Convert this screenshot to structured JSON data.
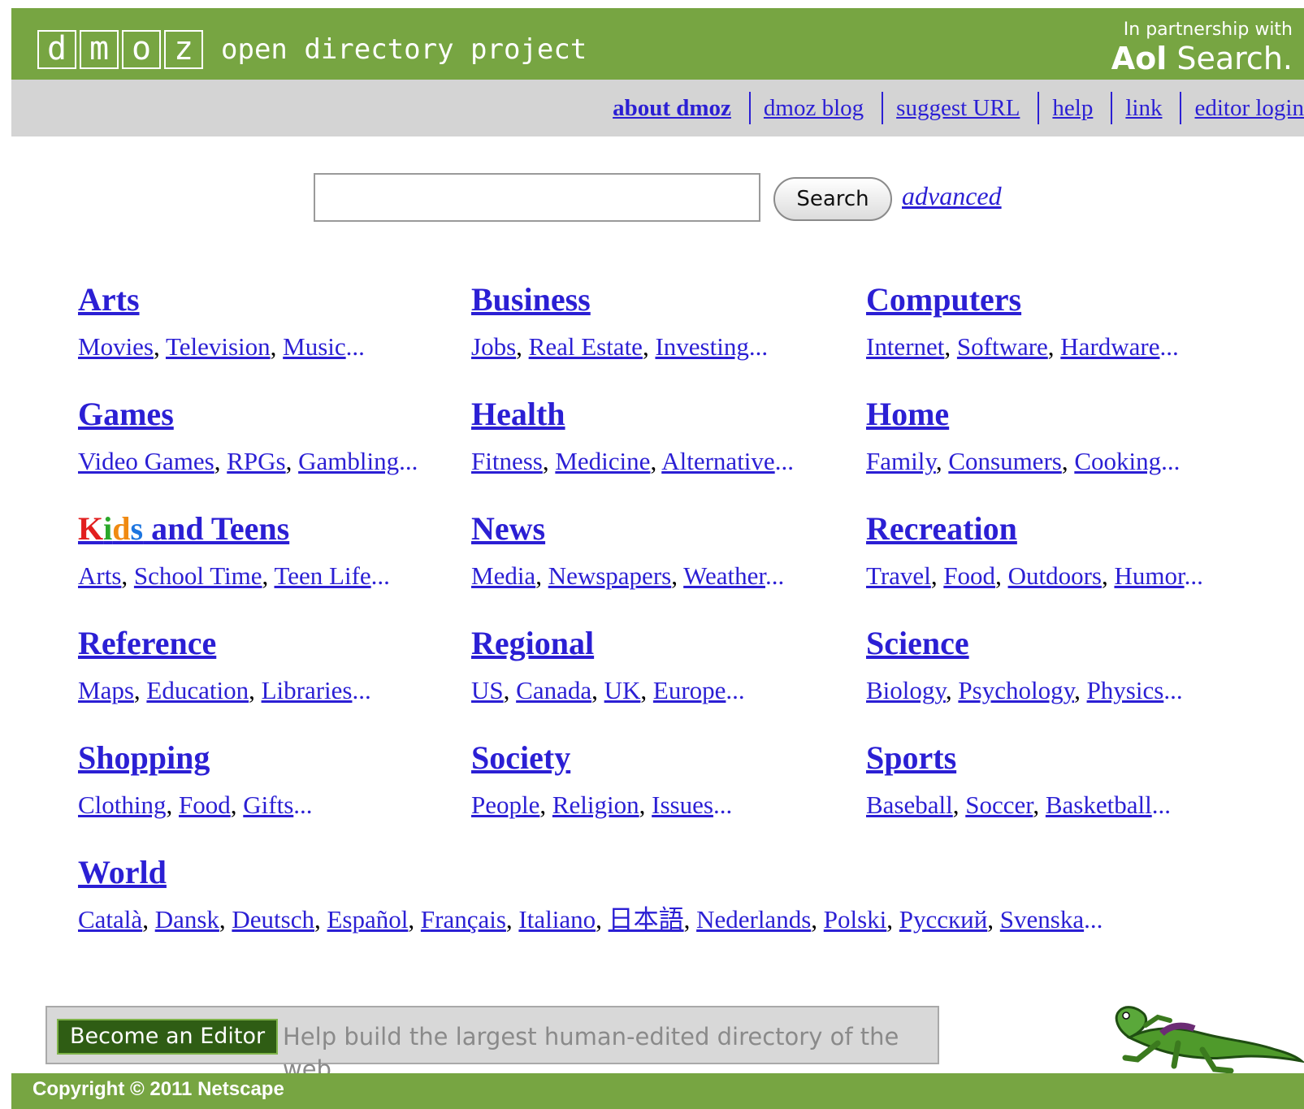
{
  "header": {
    "logo_letters": [
      "d",
      "m",
      "o",
      "z"
    ],
    "tagline": "open directory project",
    "partner_small": "In partnership with",
    "partner_brand_bold": "Aol",
    "partner_brand_rest": " Search."
  },
  "nav": {
    "items": [
      {
        "label": "about dmoz",
        "bold": true
      },
      {
        "label": "dmoz blog"
      },
      {
        "label": "suggest URL"
      },
      {
        "label": "help"
      },
      {
        "label": "link"
      },
      {
        "label": "editor login"
      }
    ]
  },
  "search": {
    "value": "",
    "placeholder": "",
    "button_label": "Search",
    "advanced_label": "advanced"
  },
  "categories": [
    {
      "title": "Arts",
      "subs": [
        "Movies",
        "Television",
        "Music"
      ]
    },
    {
      "title": "Business",
      "subs": [
        "Jobs",
        "Real Estate",
        "Investing"
      ]
    },
    {
      "title": "Computers",
      "subs": [
        "Internet",
        "Software",
        "Hardware"
      ]
    },
    {
      "title": "Games",
      "subs": [
        "Video Games",
        "RPGs",
        "Gambling"
      ]
    },
    {
      "title": "Health",
      "subs": [
        "Fitness",
        "Medicine",
        "Alternative"
      ]
    },
    {
      "title": "Home",
      "subs": [
        "Family",
        "Consumers",
        "Cooking"
      ]
    },
    {
      "title_kids": [
        "K",
        "i",
        "d",
        "s"
      ],
      "title_rest": " and Teens",
      "subs": [
        "Arts",
        "School Time",
        "Teen Life"
      ]
    },
    {
      "title": "News",
      "subs": [
        "Media",
        "Newspapers",
        "Weather"
      ]
    },
    {
      "title": "Recreation",
      "subs": [
        "Travel",
        "Food",
        "Outdoors",
        "Humor"
      ]
    },
    {
      "title": "Reference",
      "subs": [
        "Maps",
        "Education",
        "Libraries"
      ]
    },
    {
      "title": "Regional",
      "subs": [
        "US",
        "Canada",
        "UK",
        "Europe"
      ]
    },
    {
      "title": "Science",
      "subs": [
        "Biology",
        "Psychology",
        "Physics"
      ]
    },
    {
      "title": "Shopping",
      "subs": [
        "Clothing",
        "Food",
        "Gifts"
      ]
    },
    {
      "title": "Society",
      "subs": [
        "People",
        "Religion",
        "Issues"
      ]
    },
    {
      "title": "Sports",
      "subs": [
        "Baseball",
        "Soccer",
        "Basketball"
      ]
    },
    {
      "title": "World",
      "subs": [
        "Català",
        "Dansk",
        "Deutsch",
        "Español",
        "Français",
        "Italiano",
        "日本語",
        "Nederlands",
        "Polski",
        "Русский",
        "Svenska"
      ]
    }
  ],
  "ellipsis": "...",
  "separator": ", ",
  "editor": {
    "button_label": "Become an Editor",
    "text": "Help build the largest human-edited directory of the web"
  },
  "mascot": {
    "icon": "dinosaur-mascot-icon"
  },
  "footer": {
    "copyright": "Copyright © 2011 Netscape"
  },
  "colors": {
    "header_green": "#77a542",
    "nav_gray": "#d4d4d4",
    "link_blue": "#2b1fd4"
  }
}
